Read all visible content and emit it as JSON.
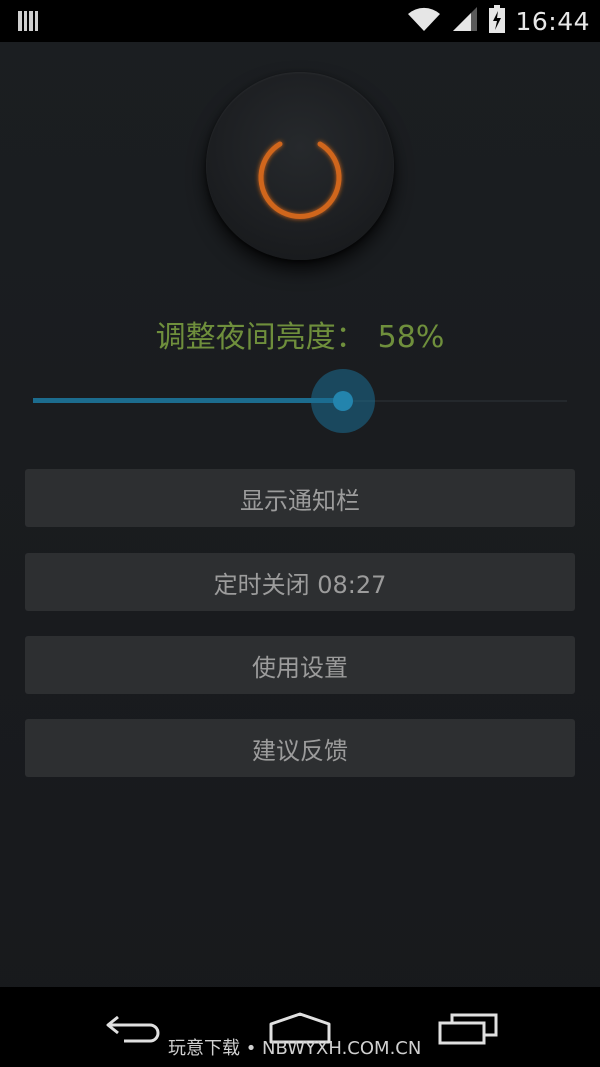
{
  "status_bar": {
    "time": "16:44",
    "icons": [
      "barcode-icon",
      "wifi-icon",
      "signal-icon",
      "battery-charging-icon"
    ]
  },
  "power_button": {
    "icon": "power-icon",
    "color": "#d0661c"
  },
  "brightness": {
    "label": "调整夜间亮度：",
    "value_text": "58%",
    "value": 0.58,
    "label_color": "#6f8f3c",
    "accent_color": "#2384ad"
  },
  "menu": {
    "show_notification": "显示通知栏",
    "timer_off": "定时关闭 08:27",
    "usage_settings": "使用设置",
    "feedback": "建议反馈"
  },
  "nav_bar": {
    "icons": [
      "back-icon",
      "home-icon",
      "recent-apps-icon"
    ]
  },
  "watermark": "玩意下载 • NBWYXH.COM.CN"
}
